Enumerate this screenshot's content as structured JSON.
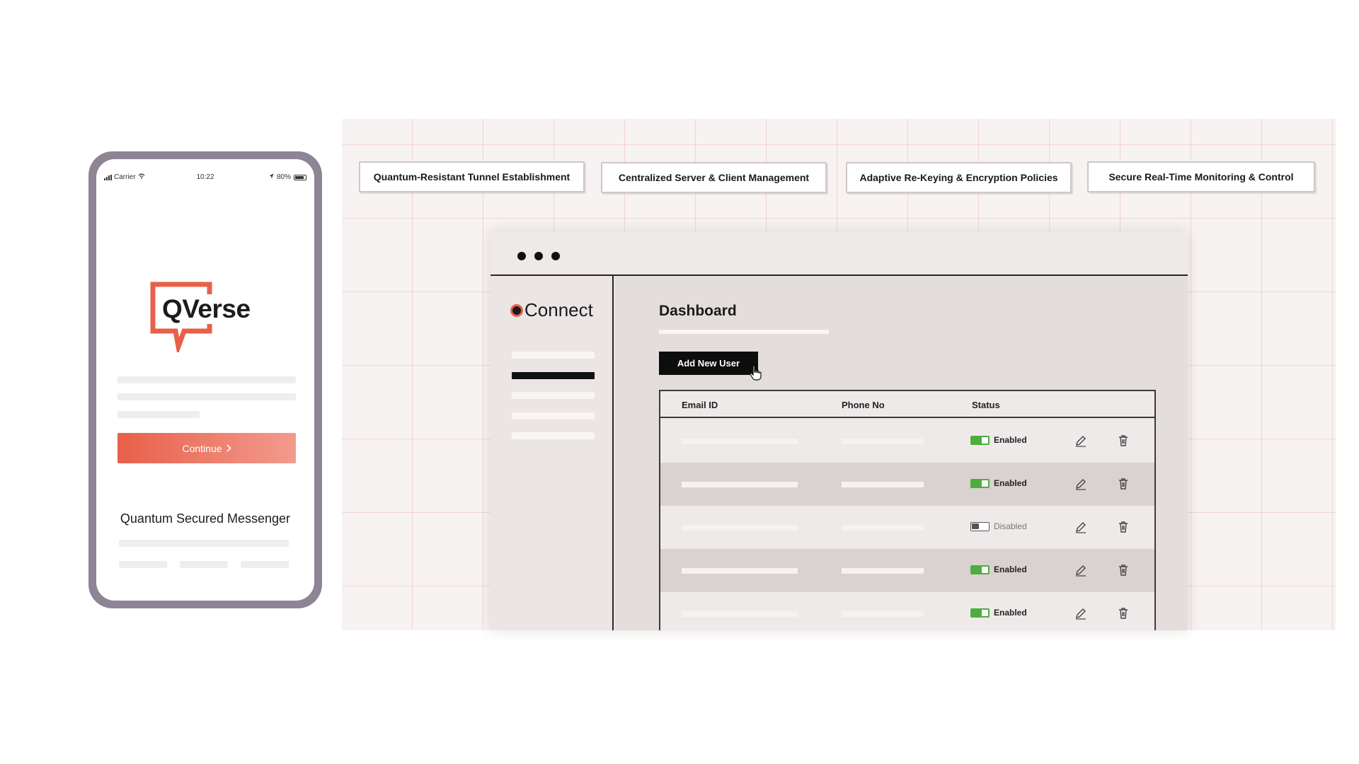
{
  "features": [
    "Quantum-Resistant Tunnel Establishment",
    "Centralized Server & Client Management",
    "Adaptive Re-Keying & Encryption Policies",
    "Secure Real-Time Monitoring & Control"
  ],
  "phone": {
    "carrier": "Carrier",
    "time": "10:22",
    "battery": "80%",
    "logo": "QVerse",
    "continue_label": "Continue",
    "tagline": "Quantum Secured Messenger",
    "accent_color": "#e8604a"
  },
  "dashboard": {
    "brand": "Connect",
    "page_title": "Dashboard",
    "add_button": "Add New User",
    "columns": [
      "Email ID",
      "Phone No",
      "Status"
    ],
    "rows": [
      {
        "status": "Enabled",
        "enabled": true
      },
      {
        "status": "Enabled",
        "enabled": true
      },
      {
        "status": "Disabled",
        "enabled": false
      },
      {
        "status": "Enabled",
        "enabled": true
      },
      {
        "status": "Enabled",
        "enabled": true
      }
    ],
    "enabled_color": "#4cae3f"
  }
}
